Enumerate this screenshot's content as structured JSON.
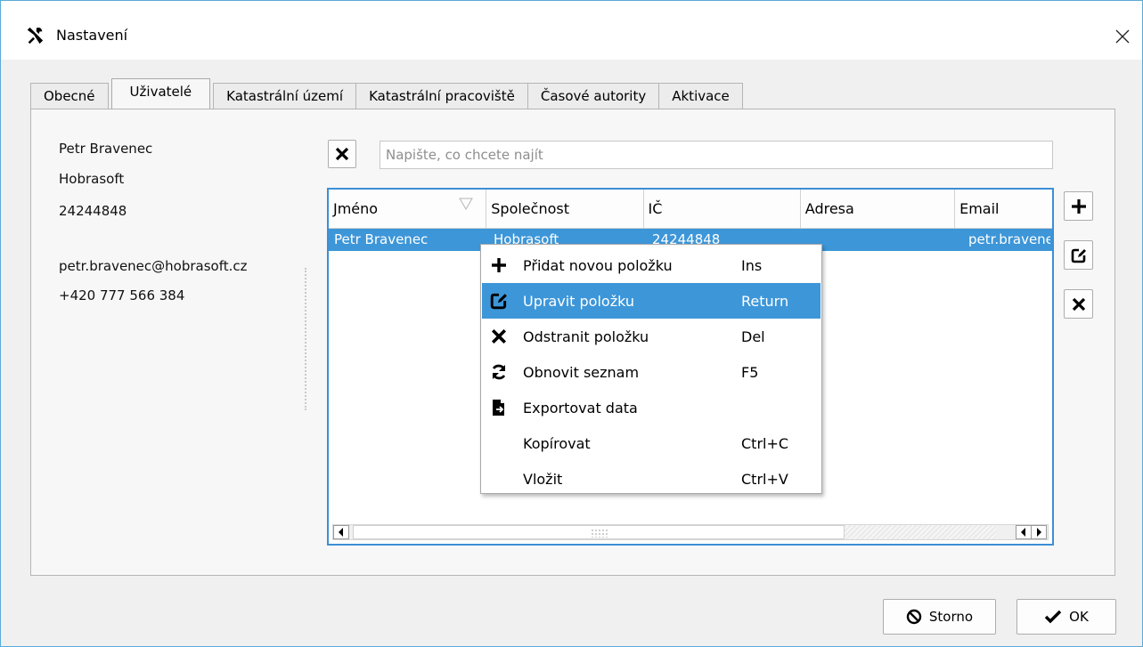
{
  "window": {
    "title": "Nastavení"
  },
  "tabs": [
    {
      "label": "Obecné",
      "active": false
    },
    {
      "label": "Uživatelé",
      "active": true
    },
    {
      "label": "Katastrální území",
      "active": false
    },
    {
      "label": "Katastrální pracoviště",
      "active": false
    },
    {
      "label": "Časové autority",
      "active": false
    },
    {
      "label": "Aktivace",
      "active": false
    }
  ],
  "user_info": {
    "name": "Petr Bravenec",
    "company": "Hobrasoft",
    "ic": "24244848",
    "email": "petr.bravenec@hobrasoft.cz",
    "phone": "+420 777 566 384"
  },
  "search": {
    "value": "",
    "placeholder": "Napište, co chcete najít"
  },
  "table": {
    "columns": [
      "Jméno",
      "Společnost",
      "IČ",
      "Adresa",
      "Email"
    ],
    "rows": [
      [
        "Petr Bravenec",
        "Hobrasoft",
        "24244848",
        "",
        "petr.bravenec@hobrasoft.cz"
      ]
    ]
  },
  "context_menu": [
    {
      "label": "Přidat novou položku",
      "key": "Ins",
      "icon": "plus-icon",
      "highlighted": false
    },
    {
      "label": "Upravit položku",
      "key": "Return",
      "icon": "edit-icon",
      "highlighted": true
    },
    {
      "label": "Odstranit položku",
      "key": "Del",
      "icon": "x-icon",
      "highlighted": false
    },
    {
      "label": "Obnovit seznam",
      "key": "F5",
      "icon": "refresh-icon",
      "highlighted": false
    },
    {
      "label": "Exportovat data",
      "key": "",
      "icon": "export-icon",
      "highlighted": false
    },
    {
      "label": "Kopírovat",
      "key": "Ctrl+C",
      "icon": "",
      "highlighted": false
    },
    {
      "label": "Vložit",
      "key": "Ctrl+V",
      "icon": "",
      "highlighted": false
    }
  ],
  "buttons": {
    "cancel": "Storno",
    "ok": "OK"
  },
  "colors": {
    "accent": "#3d96d8",
    "focus_border": "#3c8fd6"
  }
}
